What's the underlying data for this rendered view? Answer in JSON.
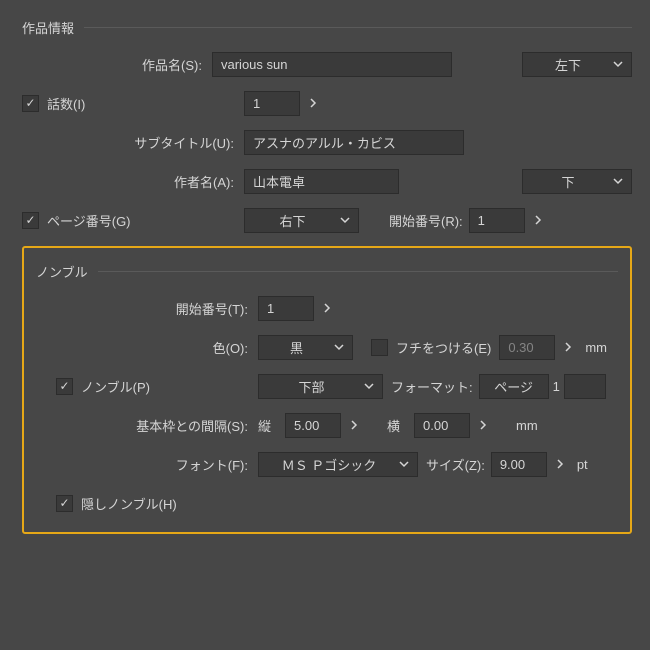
{
  "sections": {
    "work_info": {
      "title": "作品情報",
      "work_name": {
        "label": "作品名(S):",
        "value": "various sun",
        "position": "左下"
      },
      "episode": {
        "checkbox_label": "話数(I)",
        "value": "1"
      },
      "subtitle": {
        "label": "サブタイトル(U):",
        "value": "アスナのアルル・カビス"
      },
      "author": {
        "label": "作者名(A):",
        "value": "山本電卓",
        "position": "下"
      },
      "page_number": {
        "checkbox_label": "ページ番号(G)",
        "position": "右下",
        "start_label": "開始番号(R):",
        "start_value": "1"
      }
    },
    "nombre": {
      "title": "ノンブル",
      "start": {
        "label": "開始番号(T):",
        "value": "1"
      },
      "color": {
        "label": "色(O):",
        "value": "黒",
        "border_label": "フチをつける(E)",
        "border_value": "0.30",
        "unit": "mm"
      },
      "nombre_row": {
        "checkbox_label": "ノンブル(P)",
        "position": "下部",
        "format_label": "フォーマット:",
        "format_value": "ページ",
        "suffix": "1"
      },
      "gap": {
        "label": "基本枠との間隔(S):",
        "v_label": "縦",
        "v_value": "5.00",
        "h_label": "横",
        "h_value": "0.00",
        "unit": "mm"
      },
      "font": {
        "label": "フォント(F):",
        "value": "ＭＳ Ｐゴシック",
        "size_label": "サイズ(Z):",
        "size_value": "9.00",
        "unit": "pt"
      },
      "hidden": {
        "label": "隠しノンブル(H)"
      }
    }
  }
}
